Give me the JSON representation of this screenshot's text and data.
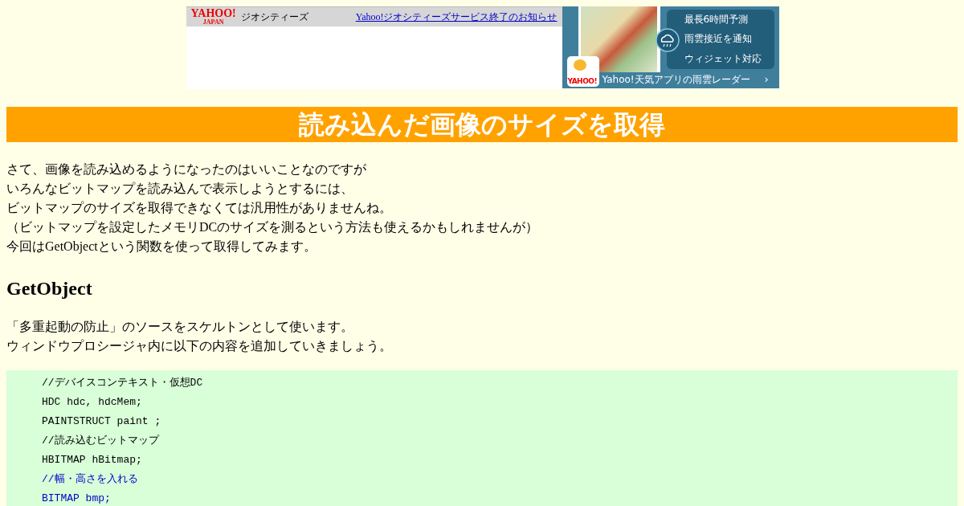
{
  "ad_left": {
    "logo": "YAHOO!",
    "logo_sub": "JAPAN",
    "service": "ジオシティーズ",
    "link": "Yahoo!ジオシティーズサービス終了のお知らせ"
  },
  "ad_right": {
    "features": [
      "最長6時間予測",
      "雨雲接近を通知",
      "ウィジェット対応"
    ],
    "app_icon_label": "YAHOO!",
    "caption": "Yahoo!天気アプリの雨雲レーダー",
    "arrow": "›"
  },
  "title": "読み込んだ画像のサイズを取得",
  "intro": [
    "さて、画像を読み込めるようになったのはいいことなのですが",
    "いろんなビットマップを読み込んで表示しようとするには、",
    "ビットマップのサイズを取得できなくては汎用性がありませんね。",
    "（ビットマップを設定したメモリDCのサイズを測るという方法も使えるかもしれませんが）",
    "今回はGetObjectという関数を使って取得してみます。"
  ],
  "section_heading": "GetObject",
  "section_text": [
    "「多重起動の防止」のソースをスケルトンとして使います。",
    "ウィンドウプロシージャ内に以下の内容を追加していきましょう。"
  ],
  "code": [
    {
      "text": "//デバイスコンテキスト・仮想DC",
      "highlighted": false
    },
    {
      "text": "HDC hdc, hdcMem;",
      "highlighted": false
    },
    {
      "text": "PAINTSTRUCT paint ;",
      "highlighted": false
    },
    {
      "text": "//読み込むビットマップ",
      "highlighted": false
    },
    {
      "text": "HBITMAP hBitmap;",
      "highlighted": false
    },
    {
      "text": "//幅・高さを入れる",
      "highlighted": true
    },
    {
      "text": "BITMAP bmp;",
      "highlighted": true
    }
  ]
}
